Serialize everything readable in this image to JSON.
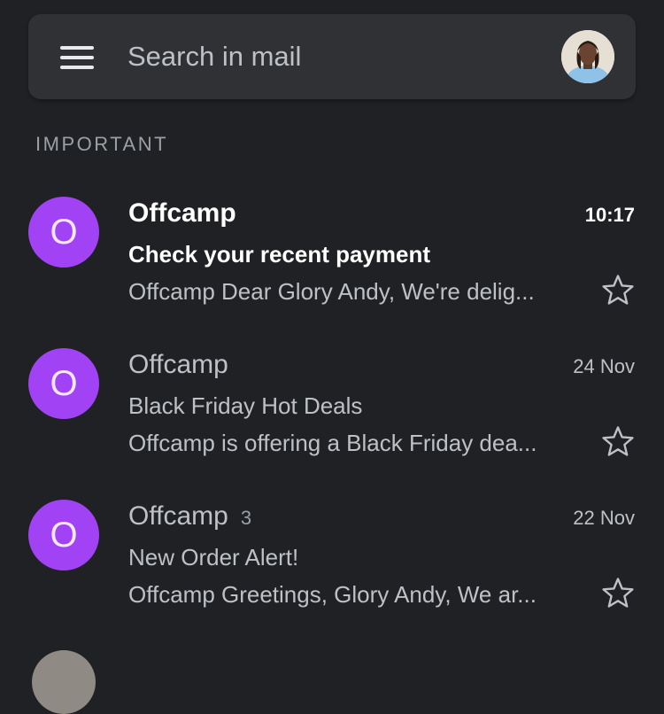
{
  "search": {
    "placeholder": "Search in mail"
  },
  "icons": {
    "menu": "hamburger-menu-icon",
    "star": "star-outline-icon"
  },
  "colors": {
    "background": "#202124",
    "searchbar": "#303134",
    "sender_avatar": "#a142f4",
    "muted_text": "#bdc1c6",
    "unread_text": "#ffffff"
  },
  "section": {
    "label": "IMPORTANT"
  },
  "emails": [
    {
      "initial": "O",
      "sender": "Offcamp",
      "count": "",
      "time": "10:17",
      "subject": "Check your recent payment",
      "snippet": "Offcamp Dear Glory Andy, We're delig...",
      "unread": true,
      "starred": false
    },
    {
      "initial": "O",
      "sender": "Offcamp",
      "count": "",
      "time": "24 Nov",
      "subject": "Black Friday Hot Deals",
      "snippet": "Offcamp is offering a Black Friday dea...",
      "unread": false,
      "starred": false
    },
    {
      "initial": "O",
      "sender": "Offcamp",
      "count": "3",
      "time": "22 Nov",
      "subject": "New Order Alert!",
      "snippet": "Offcamp Greetings, Glory Andy, We ar...",
      "unread": false,
      "starred": false
    }
  ]
}
